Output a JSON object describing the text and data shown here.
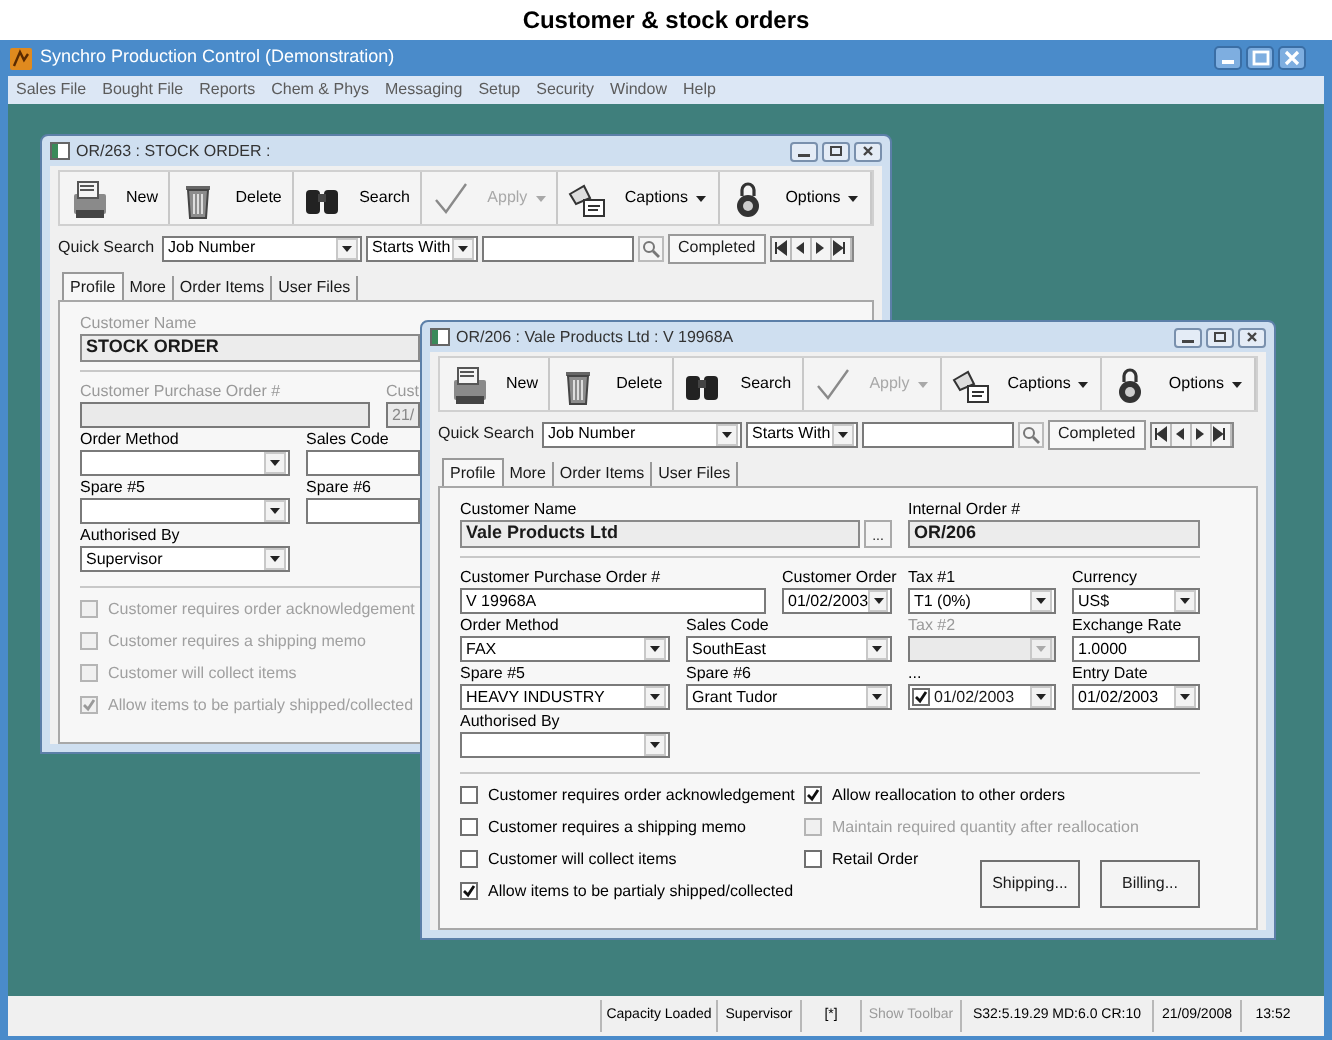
{
  "caption": "Customer & stock orders",
  "app": {
    "title": "Synchro Production Control (Demonstration)",
    "menu": [
      "Sales File",
      "Bought File",
      "Reports",
      "Chem & Phys",
      "Messaging",
      "Setup",
      "Security",
      "Window",
      "Help"
    ]
  },
  "windows": [
    {
      "title": "OR/263 : STOCK ORDER :",
      "toolbar": [
        {
          "kind": "new",
          "label": "New",
          "disabled": false,
          "dropdown": false
        },
        {
          "kind": "delete",
          "label": "Delete",
          "disabled": false,
          "dropdown": false
        },
        {
          "kind": "search",
          "label": "Search",
          "disabled": false,
          "dropdown": false
        },
        {
          "kind": "apply",
          "label": "Apply",
          "disabled": true,
          "dropdown": true
        },
        {
          "kind": "captions",
          "label": "Captions",
          "disabled": false,
          "dropdown": true
        },
        {
          "kind": "options",
          "label": "Options",
          "disabled": false,
          "dropdown": true
        }
      ],
      "quick_search": {
        "label": "Quick Search",
        "field": "Job Number",
        "match": "Starts With",
        "completed": "Completed"
      },
      "tabs": [
        {
          "label": "Profile",
          "selected": true
        },
        {
          "label": "More",
          "selected": false
        },
        {
          "label": "Order Items",
          "selected": false
        },
        {
          "label": "User Files",
          "selected": false
        }
      ],
      "name_fields": [
        {
          "label": "Customer Name",
          "value": "STOCK ORDER",
          "disabled": true
        }
      ],
      "rows": [
        [
          {
            "label": "Customer Purchase Order #",
            "kind": "text",
            "disabled": true
          },
          {
            "label": "Cust",
            "kind": "text",
            "value": "21/",
            "disabled": true
          }
        ],
        [
          {
            "label": "Order Method",
            "kind": "combo",
            "disabled": false
          },
          {
            "label": "Sales Code",
            "kind": "text",
            "disabled": false
          }
        ],
        [
          {
            "label": "Spare #5",
            "kind": "combo",
            "disabled": false
          },
          {
            "label": "Spare #6",
            "kind": "text",
            "disabled": false
          }
        ],
        [
          {
            "label": "Authorised By",
            "kind": "combo",
            "value": "Supervisor",
            "disabled": false
          }
        ]
      ],
      "checkboxes": [
        [
          {
            "label": "Customer requires order acknowledgement",
            "checked": false,
            "disabled": true
          },
          {
            "label": "Customer requires a shipping memo",
            "checked": false,
            "disabled": true
          },
          {
            "label": "Customer will collect items",
            "checked": false,
            "disabled": true
          },
          {
            "label": "Allow items to be partialy shipped/collected",
            "checked": true,
            "disabled": true
          }
        ]
      ]
    },
    {
      "title": "OR/206 : Vale Products Ltd : V 19968A",
      "toolbar": [
        {
          "kind": "new",
          "label": "New",
          "disabled": false,
          "dropdown": false
        },
        {
          "kind": "delete",
          "label": "Delete",
          "disabled": false,
          "dropdown": false
        },
        {
          "kind": "search",
          "label": "Search",
          "disabled": false,
          "dropdown": false
        },
        {
          "kind": "apply",
          "label": "Apply",
          "disabled": true,
          "dropdown": true
        },
        {
          "kind": "captions",
          "label": "Captions",
          "disabled": false,
          "dropdown": true
        },
        {
          "kind": "options",
          "label": "Options",
          "disabled": false,
          "dropdown": true
        }
      ],
      "quick_search": {
        "label": "Quick Search",
        "field": "Job Number",
        "match": "Starts With",
        "completed": "Completed"
      },
      "tabs": [
        {
          "label": "Profile",
          "selected": true
        },
        {
          "label": "More",
          "selected": false
        },
        {
          "label": "Order Items",
          "selected": false
        },
        {
          "label": "User Files",
          "selected": false
        }
      ],
      "name_fields": [
        {
          "label": "Customer Name",
          "value": "Vale Products Ltd",
          "button": "...",
          "disabled": false
        },
        {
          "label": "Internal Order #",
          "value": "OR/206",
          "disabled": false
        }
      ],
      "rows": [
        [
          {
            "label": "Customer Purchase Order #",
            "kind": "text",
            "value": "V 19968A",
            "disabled": false
          },
          {
            "label": "Customer Order",
            "kind": "combo",
            "value": "01/02/2003",
            "disabled": false
          },
          {
            "label": "Tax #1",
            "kind": "combo",
            "value": "T1 (0%)",
            "disabled": false
          },
          {
            "label": "Currency",
            "kind": "combo",
            "value": "US$",
            "disabled": false
          }
        ],
        [
          {
            "label": "Order Method",
            "kind": "combo",
            "value": "FAX",
            "disabled": false
          },
          {
            "label": "Sales Code",
            "kind": "combo",
            "value": "SouthEast",
            "disabled": false
          },
          {
            "label": "Tax #2",
            "kind": "combo",
            "disabled": true
          },
          {
            "label": "Exchange Rate",
            "kind": "text",
            "value": "1.0000",
            "disabled": false
          }
        ],
        [
          {
            "label": "Spare #5",
            "kind": "combo",
            "value": "HEAVY INDUSTRY",
            "disabled": false
          },
          {
            "label": "Spare #6",
            "kind": "combo",
            "value": "Grant Tudor",
            "disabled": false
          },
          {
            "label": "...",
            "kind": "checkdate",
            "value": "01/02/2003",
            "checked": true,
            "disabled": false
          },
          {
            "label": "Entry Date",
            "kind": "combo",
            "value": "01/02/2003",
            "disabled": false
          }
        ],
        [
          {
            "label": "Authorised By",
            "kind": "combo",
            "disabled": false
          }
        ]
      ],
      "checkboxes": [
        [
          {
            "label": "Customer requires order acknowledgement",
            "checked": false,
            "disabled": false
          },
          {
            "label": "Customer requires a shipping memo",
            "checked": false,
            "disabled": false
          },
          {
            "label": "Customer will collect items",
            "checked": false,
            "disabled": false
          },
          {
            "label": "Allow items to be partialy shipped/collected",
            "checked": true,
            "disabled": false
          }
        ],
        [
          {
            "label": "Allow reallocation to other orders",
            "checked": true,
            "disabled": false
          },
          {
            "label": "Maintain required quantity after reallocation",
            "checked": false,
            "disabled": true
          },
          {
            "label": "Retail Order",
            "checked": false,
            "disabled": false
          }
        ]
      ],
      "buttons": [
        "Shipping...",
        "Billing..."
      ]
    }
  ],
  "status_bar": [
    {
      "text": "Capacity Loaded",
      "disabled": false
    },
    {
      "text": "Supervisor",
      "disabled": false
    },
    {
      "text": "[*]",
      "disabled": false
    },
    {
      "text": "Show Toolbar",
      "disabled": true
    },
    {
      "text": "S32:5.19.29 MD:6.0 CR:10",
      "disabled": false
    },
    {
      "text": "21/09/2008",
      "disabled": false
    },
    {
      "text": "13:52",
      "disabled": false
    }
  ]
}
